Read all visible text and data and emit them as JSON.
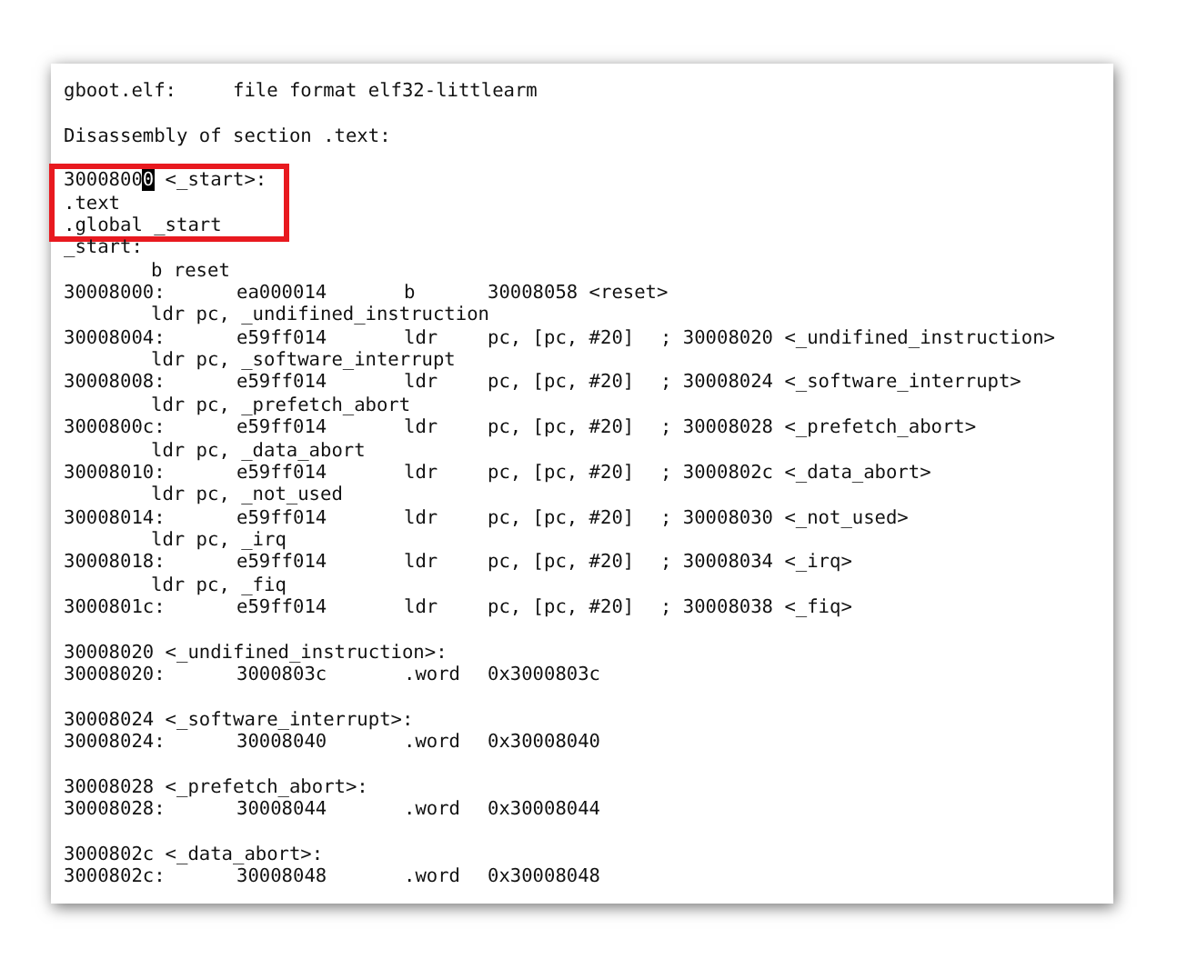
{
  "document": {
    "sections": [
      {
        "kind": "plain",
        "lines": [
          {
            "kind": "text",
            "text": "gboot.elf:     file format elf32-littlearm"
          },
          {
            "kind": "blank"
          },
          {
            "kind": "text",
            "text": "Disassembly of section .text:"
          },
          {
            "kind": "blank"
          }
        ]
      },
      {
        "kind": "callout",
        "lines": [
          {
            "kind": "cursor_line",
            "before": "3000800",
            "cursor": "0",
            "after": " <_start>:"
          },
          {
            "kind": "text",
            "text": ".text"
          },
          {
            "kind": "text",
            "text": ".global _start"
          }
        ]
      },
      {
        "kind": "plain",
        "lines": [
          {
            "kind": "text",
            "text": "_start:"
          },
          {
            "kind": "source",
            "text": "b reset"
          },
          {
            "kind": "insn",
            "address": "30008000:",
            "hex": "ea000014",
            "mnemonic": "b",
            "operands": "30008058 <reset>"
          },
          {
            "kind": "source",
            "text": "ldr pc, _undifined_instruction"
          },
          {
            "kind": "insn",
            "address": "30008004:",
            "hex": "e59ff014",
            "mnemonic": "ldr",
            "operands": "pc, [pc, #20]",
            "comment": "; 30008020 <_undifined_instruction>"
          },
          {
            "kind": "source",
            "text": "ldr pc, _software_interrupt"
          },
          {
            "kind": "insn",
            "address": "30008008:",
            "hex": "e59ff014",
            "mnemonic": "ldr",
            "operands": "pc, [pc, #20]",
            "comment": "; 30008024 <_software_interrupt>"
          },
          {
            "kind": "source",
            "text": "ldr pc, _prefetch_abort"
          },
          {
            "kind": "insn",
            "address": "3000800c:",
            "hex": "e59ff014",
            "mnemonic": "ldr",
            "operands": "pc, [pc, #20]",
            "comment": "; 30008028 <_prefetch_abort>"
          },
          {
            "kind": "source",
            "text": "ldr pc, _data_abort"
          },
          {
            "kind": "insn",
            "address": "30008010:",
            "hex": "e59ff014",
            "mnemonic": "ldr",
            "operands": "pc, [pc, #20]",
            "comment": "; 3000802c <_data_abort>"
          },
          {
            "kind": "source",
            "text": "ldr pc, _not_used"
          },
          {
            "kind": "insn",
            "address": "30008014:",
            "hex": "e59ff014",
            "mnemonic": "ldr",
            "operands": "pc, [pc, #20]",
            "comment": "; 30008030 <_not_used>"
          },
          {
            "kind": "source",
            "text": "ldr pc, _irq"
          },
          {
            "kind": "insn",
            "address": "30008018:",
            "hex": "e59ff014",
            "mnemonic": "ldr",
            "operands": "pc, [pc, #20]",
            "comment": "; 30008034 <_irq>"
          },
          {
            "kind": "source",
            "text": "ldr pc, _fiq"
          },
          {
            "kind": "insn",
            "address": "3000801c:",
            "hex": "e59ff014",
            "mnemonic": "ldr",
            "operands": "pc, [pc, #20]",
            "comment": "; 30008038 <_fiq>"
          },
          {
            "kind": "blank"
          },
          {
            "kind": "text",
            "text": "30008020 <_undifined_instruction>:"
          },
          {
            "kind": "insn",
            "address": "30008020:",
            "hex": "3000803c",
            "mnemonic": ".word",
            "operands": "0x3000803c"
          },
          {
            "kind": "blank"
          },
          {
            "kind": "text",
            "text": "30008024 <_software_interrupt>:"
          },
          {
            "kind": "insn",
            "address": "30008024:",
            "hex": "30008040",
            "mnemonic": ".word",
            "operands": "0x30008040"
          },
          {
            "kind": "blank"
          },
          {
            "kind": "text",
            "text": "30008028 <_prefetch_abort>:"
          },
          {
            "kind": "insn",
            "address": "30008028:",
            "hex": "30008044",
            "mnemonic": ".word",
            "operands": "0x30008044"
          },
          {
            "kind": "blank"
          },
          {
            "kind": "text",
            "text": "3000802c <_data_abort>:"
          },
          {
            "kind": "insn",
            "address": "3000802c:",
            "hex": "30008048",
            "mnemonic": ".word",
            "operands": "0x30008048"
          }
        ]
      }
    ]
  }
}
